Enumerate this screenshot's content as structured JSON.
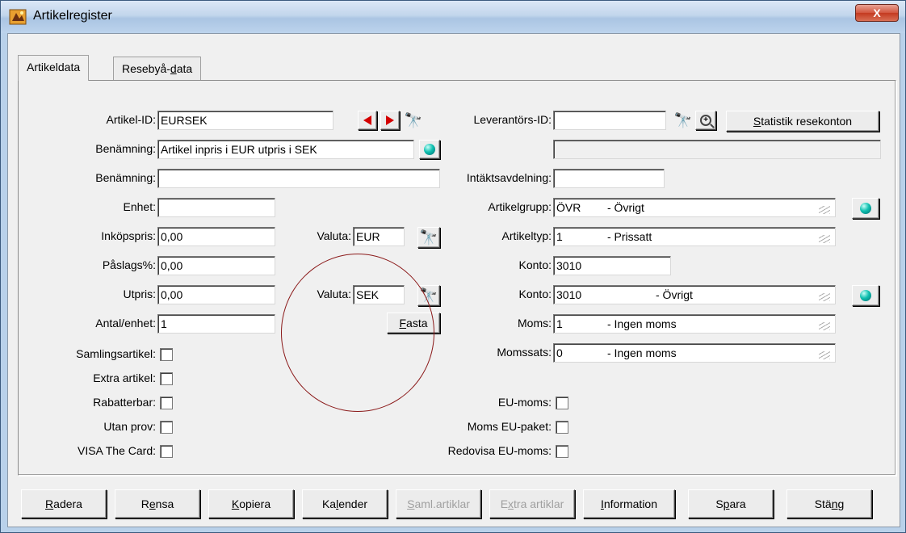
{
  "window": {
    "title": "Artikelregister",
    "close_label": "X"
  },
  "tabs": [
    {
      "label_pre": "Artikeldata",
      "label_u": "",
      "label_post": ""
    },
    {
      "label_pre": "Resebyå-",
      "label_u": "d",
      "label_post": "ata"
    }
  ],
  "left": {
    "artikel_id_label": "Artikel-ID:",
    "artikel_id_value": "EURSEK",
    "benamning1_label": "Benämning:",
    "benamning1_value": "Artikel inpris i EUR utpris i SEK",
    "benamning2_label": "Benämning:",
    "benamning2_value": "",
    "enhet_label": "Enhet:",
    "enhet_value": "",
    "inkopspris_label": "Inköpspris:",
    "inkopspris_value": "0,00",
    "paslags_label": "Påslags%:",
    "paslags_value": "0,00",
    "utpris_label": "Utpris:",
    "utpris_value": "0,00",
    "antal_label": "Antal/enhet:",
    "antal_value": "1"
  },
  "valuta": {
    "label1": "Valuta:",
    "value1": "EUR",
    "label2": "Valuta:",
    "value2": "SEK",
    "fasta_u": "F",
    "fasta_rest": "asta"
  },
  "checkboxes_left": [
    {
      "label": "Samlingsartikel:"
    },
    {
      "label": "Extra artikel:"
    },
    {
      "label": "Rabatterbar:"
    },
    {
      "label": "Utan prov:"
    },
    {
      "label": "VISA The Card:"
    }
  ],
  "right": {
    "leverantor_label": "Leverantörs-ID:",
    "leverantor_value": "",
    "statistik_u": "S",
    "statistik_rest": "tatistik resekonton",
    "leverantor_name_value": "",
    "intakts_label": "Intäktsavdelning:",
    "intakts_value": "",
    "artikelgrupp_label": "Artikelgrupp:",
    "artikelgrupp_code": "ÖVR",
    "artikelgrupp_desc": "- Övrigt",
    "artikeltyp_label": "Artikeltyp:",
    "artikeltyp_code": "1",
    "artikeltyp_desc": "- Prissatt",
    "konto1_label": "Konto:",
    "konto1_value": "3010",
    "konto2_label": "Konto:",
    "konto2_code": "3010",
    "konto2_desc": "- Övrigt",
    "moms_label": "Moms:",
    "moms_code": "1",
    "moms_desc": "- Ingen moms",
    "momssats_label": "Momssats:",
    "momssats_code": "0",
    "momssats_desc": "- Ingen moms"
  },
  "checkboxes_right": [
    {
      "label": "EU-moms:"
    },
    {
      "label": "Moms EU-paket:"
    },
    {
      "label": "Redovisa EU-moms:"
    }
  ],
  "bottom_buttons": [
    {
      "u": "R",
      "rest": "adera",
      "pre": ""
    },
    {
      "pre": "R",
      "u": "e",
      "rest": "nsa"
    },
    {
      "u": "K",
      "rest": "opiera",
      "pre": ""
    },
    {
      "pre": "Ka",
      "u": "l",
      "rest": "ender"
    },
    {
      "pre": "",
      "u": "S",
      "rest": "aml.artiklar"
    },
    {
      "pre": "E",
      "u": "x",
      "rest": "tra artiklar"
    },
    {
      "u": "I",
      "rest": "nformation",
      "pre": ""
    },
    {
      "pre": "S",
      "u": "p",
      "rest": "ara"
    },
    {
      "pre": "Stä",
      "u": "n",
      "rest": "g"
    }
  ]
}
